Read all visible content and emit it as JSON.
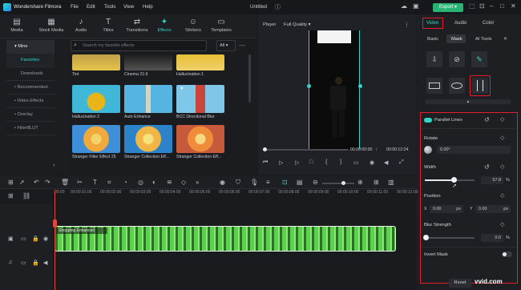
{
  "app": {
    "title": "Wondershare Filmora",
    "project": "Untitled"
  },
  "menu": [
    "File",
    "Edit",
    "Tools",
    "View",
    "Help"
  ],
  "export_label": "Export",
  "tools": [
    "Media",
    "Stock Media",
    "Audio",
    "Titles",
    "Transitions",
    "Effects",
    "Stickers",
    "Templates"
  ],
  "sidebar": [
    "Mine",
    "Favorites",
    "Downloads",
    "Recommended",
    "Video Effects",
    "Overlay",
    "Filter8LUT"
  ],
  "search": {
    "placeholder": "Search my favorite effects",
    "filter": "All"
  },
  "effects": [
    {
      "label": "Tint"
    },
    {
      "label": "Cinema 21:9"
    },
    {
      "label": "Hallucination 1"
    },
    {
      "label": "Hallucination 2"
    },
    {
      "label": "Auto Enhance"
    },
    {
      "label": "BCC Directional Blur"
    },
    {
      "label": "Stranger Filter Effect 25"
    },
    {
      "label": "Stranger Collection Eff..."
    },
    {
      "label": "Stranger Collection Eff..."
    }
  ],
  "player": {
    "label": "Player",
    "quality": "Full Quality",
    "current": "00:00:00:00",
    "total": "00:00:12:24"
  },
  "right": {
    "tabs": [
      "Video",
      "Audio",
      "Color"
    ],
    "subtabs": [
      "Basic",
      "Mask",
      "AI Tools"
    ],
    "mask_title": "Parallel Lines",
    "rotate_label": "Rotate",
    "rotate_value": "0.00°",
    "width_label": "Width",
    "width_value": "57.8",
    "width_unit": "%",
    "position_label": "Position",
    "x_label": "X",
    "x_value": "0.00",
    "x_unit": "px",
    "y_label": "Y",
    "y_value": "0.00",
    "y_unit": "px",
    "blur_label": "Blur Strength",
    "blur_value": "0.0",
    "blur_unit": "%",
    "invert_label": "Invert Mask",
    "reset": "Reset"
  },
  "timeline": {
    "ticks": [
      "00:00",
      "00:00:01:00",
      "00:00:02:00",
      "00:00:03:00",
      "00:00:04:00",
      "00:00:05:00",
      "00:00:06:00",
      "00:00:07:00",
      "00:00:08:00",
      "00:00:09:00",
      "00:00:10:00",
      "00:00:11:00",
      "00:00:12:00"
    ],
    "clip_label": "Shopping Enhanced"
  },
  "watermark": "vvid.com",
  "colors": {
    "accent": "#2fd7c8",
    "highlight": "#e01f2b",
    "export": "#28b573",
    "clip": "#5ed04f"
  }
}
